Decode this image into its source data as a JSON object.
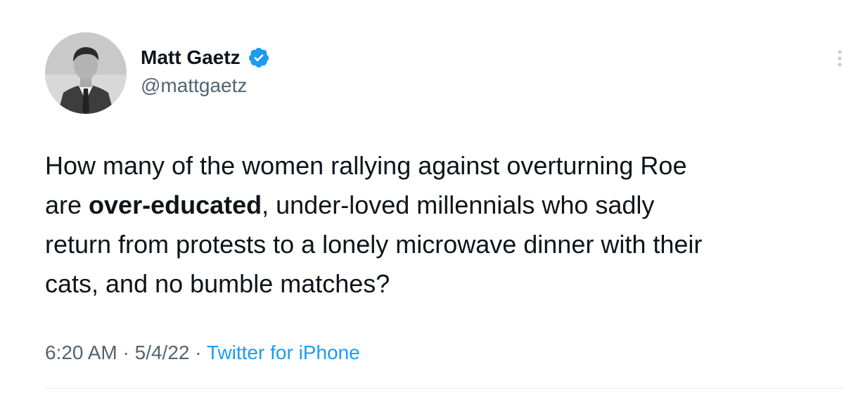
{
  "author": {
    "display_name": "Matt Gaetz",
    "handle": "@mattgaetz",
    "verified": true,
    "verified_color": "#1d9bf0"
  },
  "tweet": {
    "text_line1": "How many of the women rallying against overturning Roe",
    "text_line2_pre": "are ",
    "text_line2_bold": "over-educated",
    "text_line2_post": ", under-loved millennials who sadly",
    "text_line3": "return from protests to a lonely microwave dinner with their",
    "text_line4": "cats, and no bumble matches?"
  },
  "meta": {
    "time": "6:20 AM",
    "separator": " · ",
    "date": "5/4/22",
    "source": "Twitter for iPhone",
    "source_color": "#1d9bf0"
  }
}
